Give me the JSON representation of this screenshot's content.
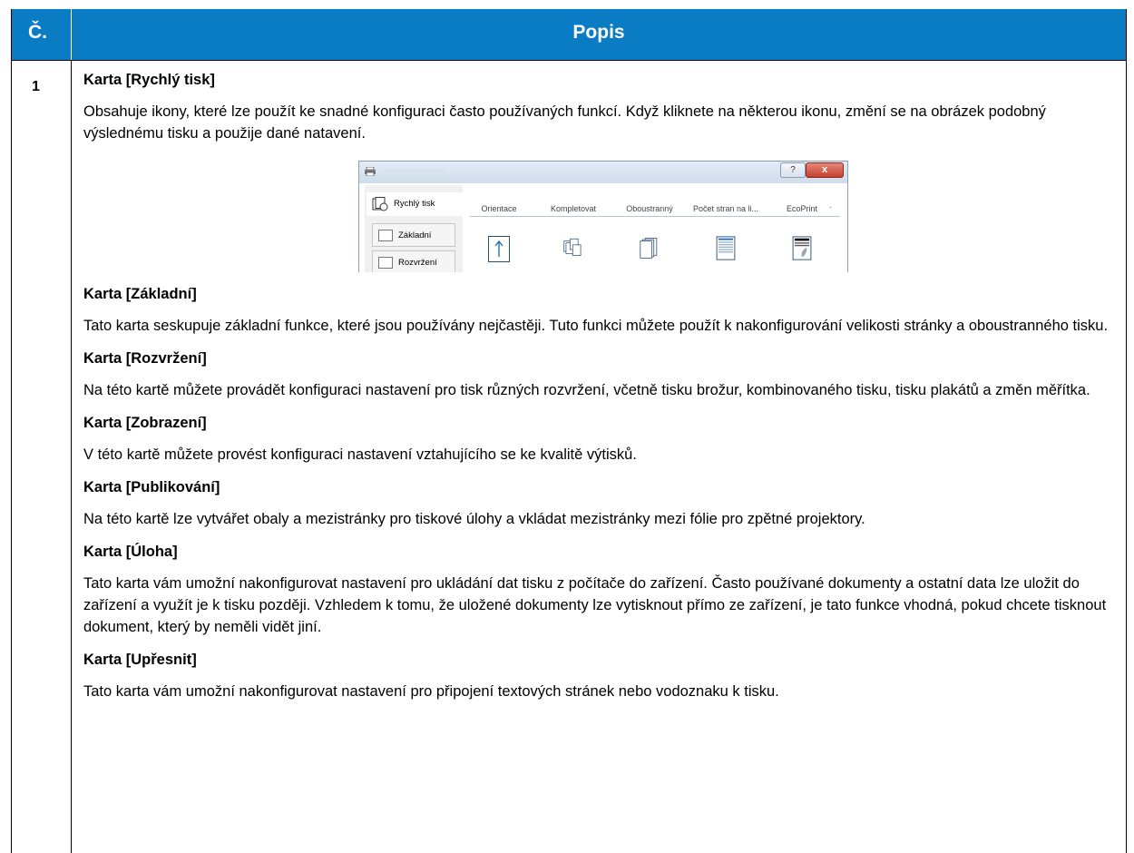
{
  "header": {
    "col1": "Č.",
    "col2": "Popis"
  },
  "row_number": "1",
  "sections": [
    {
      "title": "Karta [Rychlý tisk]",
      "text": "Obsahuje ikony, které lze použít ke snadné konfiguraci často používaných funkcí. Když kliknete na některou ikonu, změní se na obrázek podobný výslednému tisku a použije dané natavení."
    },
    {
      "title": "Karta [Základní]",
      "text": "Tato karta seskupuje základní funkce, které jsou používány nejčastěji. Tuto funkci můžete použít k nakonfigurování velikosti stránky a oboustranného tisku."
    },
    {
      "title": "Karta [Rozvržení]",
      "text": "Na této kartě můžete provádět konfiguraci nastavení pro tisk různých rozvržení, včetně tisku brožur, kombinovaného tisku, tisku plakátů a změn měřítka."
    },
    {
      "title": "Karta [Zobrazení]",
      "text": "V této kartě můžete provést konfiguraci nastavení vztahujícího se ke kvalitě výtisků."
    },
    {
      "title": "Karta [Publikování]",
      "text": "Na této kartě lze vytvářet obaly a mezistránky pro tiskové úlohy a vkládat mezistránky mezi fólie pro zpětné projektory."
    },
    {
      "title": "Karta [Úloha]",
      "text": "Tato karta vám umožní nakonfigurovat nastavení pro ukládání dat tisku z počítače do zařízení. Často používané dokumenty a ostatní data lze uložit do zařízení a využít je k tisku později. Vzhledem k tomu, že uložené dokumenty lze vytisknout přímo ze zařízení, je tato funkce vhodná, pokud chcete tisknout dokument, který by neměli vidět jiní."
    },
    {
      "title": "Karta [Upřesnit]",
      "text": "Tato karta vám umožní nakonfigurovat nastavení pro připojení textových stránek nebo vodoznaku k tisku."
    }
  ],
  "figure": {
    "help_label": "?",
    "close_label": "x",
    "sidebar": [
      "Rychlý tisk",
      "Základní",
      "Rozvržení"
    ],
    "columns": [
      "Orientace",
      "Kompletovat",
      "Oboustranný",
      "Počet stran na li...",
      "EcoPrint"
    ],
    "more": ".",
    "dots": "■■■■▸"
  },
  "colors": {
    "header_bg": "#0a7cc4",
    "header_text": "#ffffff",
    "accent": "#1e6fc0"
  }
}
